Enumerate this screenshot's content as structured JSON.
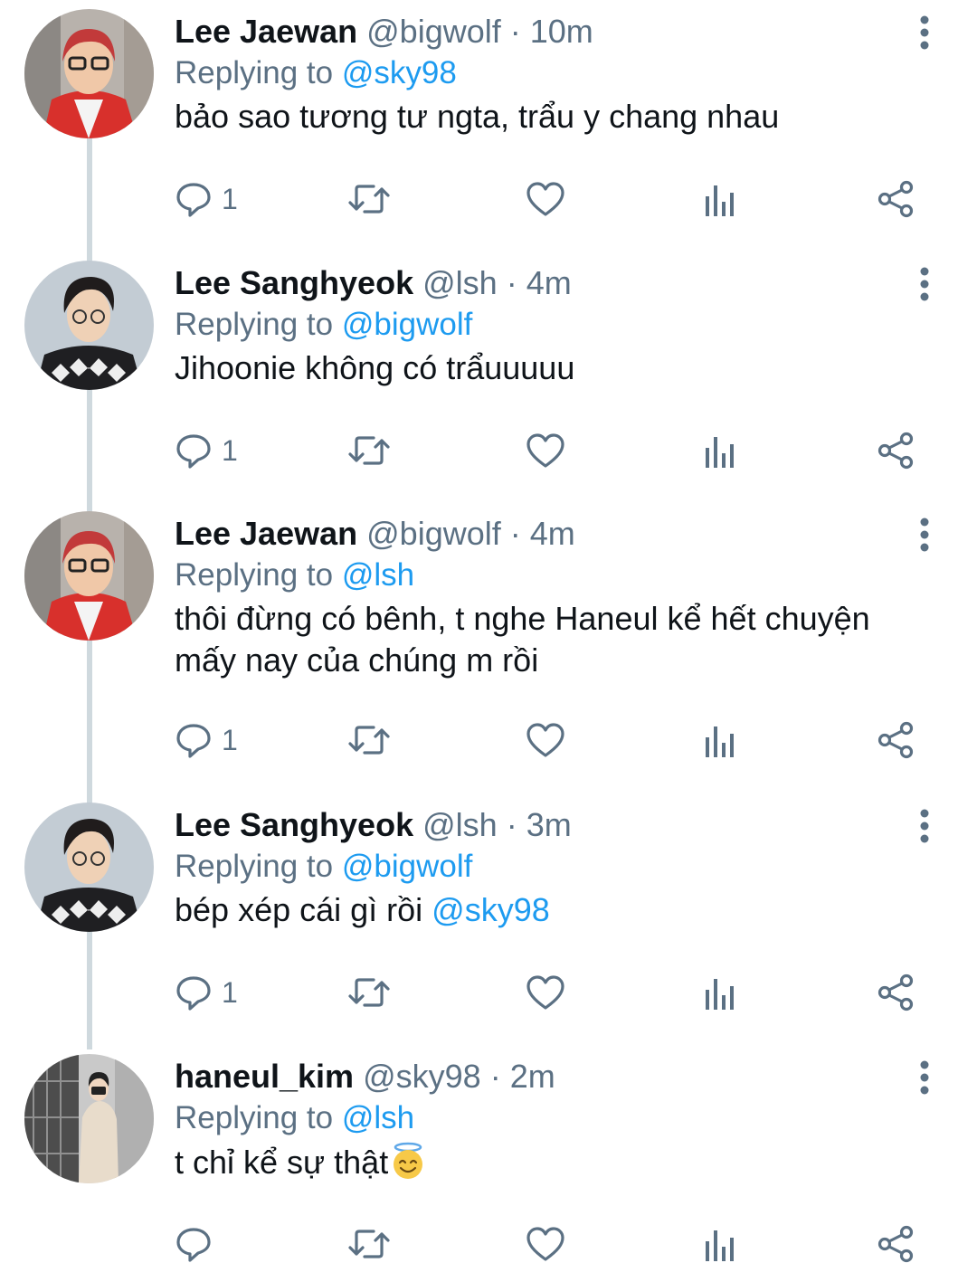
{
  "colors": {
    "accent": "#1d9bf0",
    "muted": "#5b7083",
    "text": "#0f1419",
    "thread": "#cfd9de"
  },
  "tweets": [
    {
      "name": "Lee Jaewan",
      "handle": "@bigwolf",
      "time": "· 10m",
      "replying_label": "Replying to",
      "replying_to": "@sky98",
      "text": "bảo sao tương tư ngta, trẩu y chang nhau",
      "reply_count": "1",
      "avatar": "red-hair-glasses"
    },
    {
      "name": "Lee Sanghyeok",
      "handle": "@lsh",
      "time": "· 4m",
      "replying_label": "Replying to",
      "replying_to": "@bigwolf",
      "text": "Jihoonie không có trẩuuuuu",
      "reply_count": "1",
      "avatar": "snowflake-sweater"
    },
    {
      "name": "Lee Jaewan",
      "handle": "@bigwolf",
      "time": "· 4m",
      "replying_label": "Replying to",
      "replying_to": "@lsh",
      "text": "thôi đừng có bênh, t nghe Haneul kể hết chuyện mấy nay của chúng m rồi",
      "reply_count": "1",
      "avatar": "red-hair-glasses"
    },
    {
      "name": "Lee Sanghyeok",
      "handle": "@lsh",
      "time": "· 3m",
      "replying_label": "Replying to",
      "replying_to": "@bigwolf",
      "text": "bép xép cái gì rồi ",
      "text_mention": "@sky98",
      "reply_count": "1",
      "avatar": "snowflake-sweater"
    },
    {
      "name": "haneul_kim",
      "handle": "@sky98",
      "time": "· 2m",
      "replying_label": "Replying to",
      "replying_to": "@lsh",
      "text": "t chỉ kể sự thật",
      "emoji": "smiling-face-with-halo",
      "reply_count": "",
      "avatar": "beige-suit"
    }
  ]
}
